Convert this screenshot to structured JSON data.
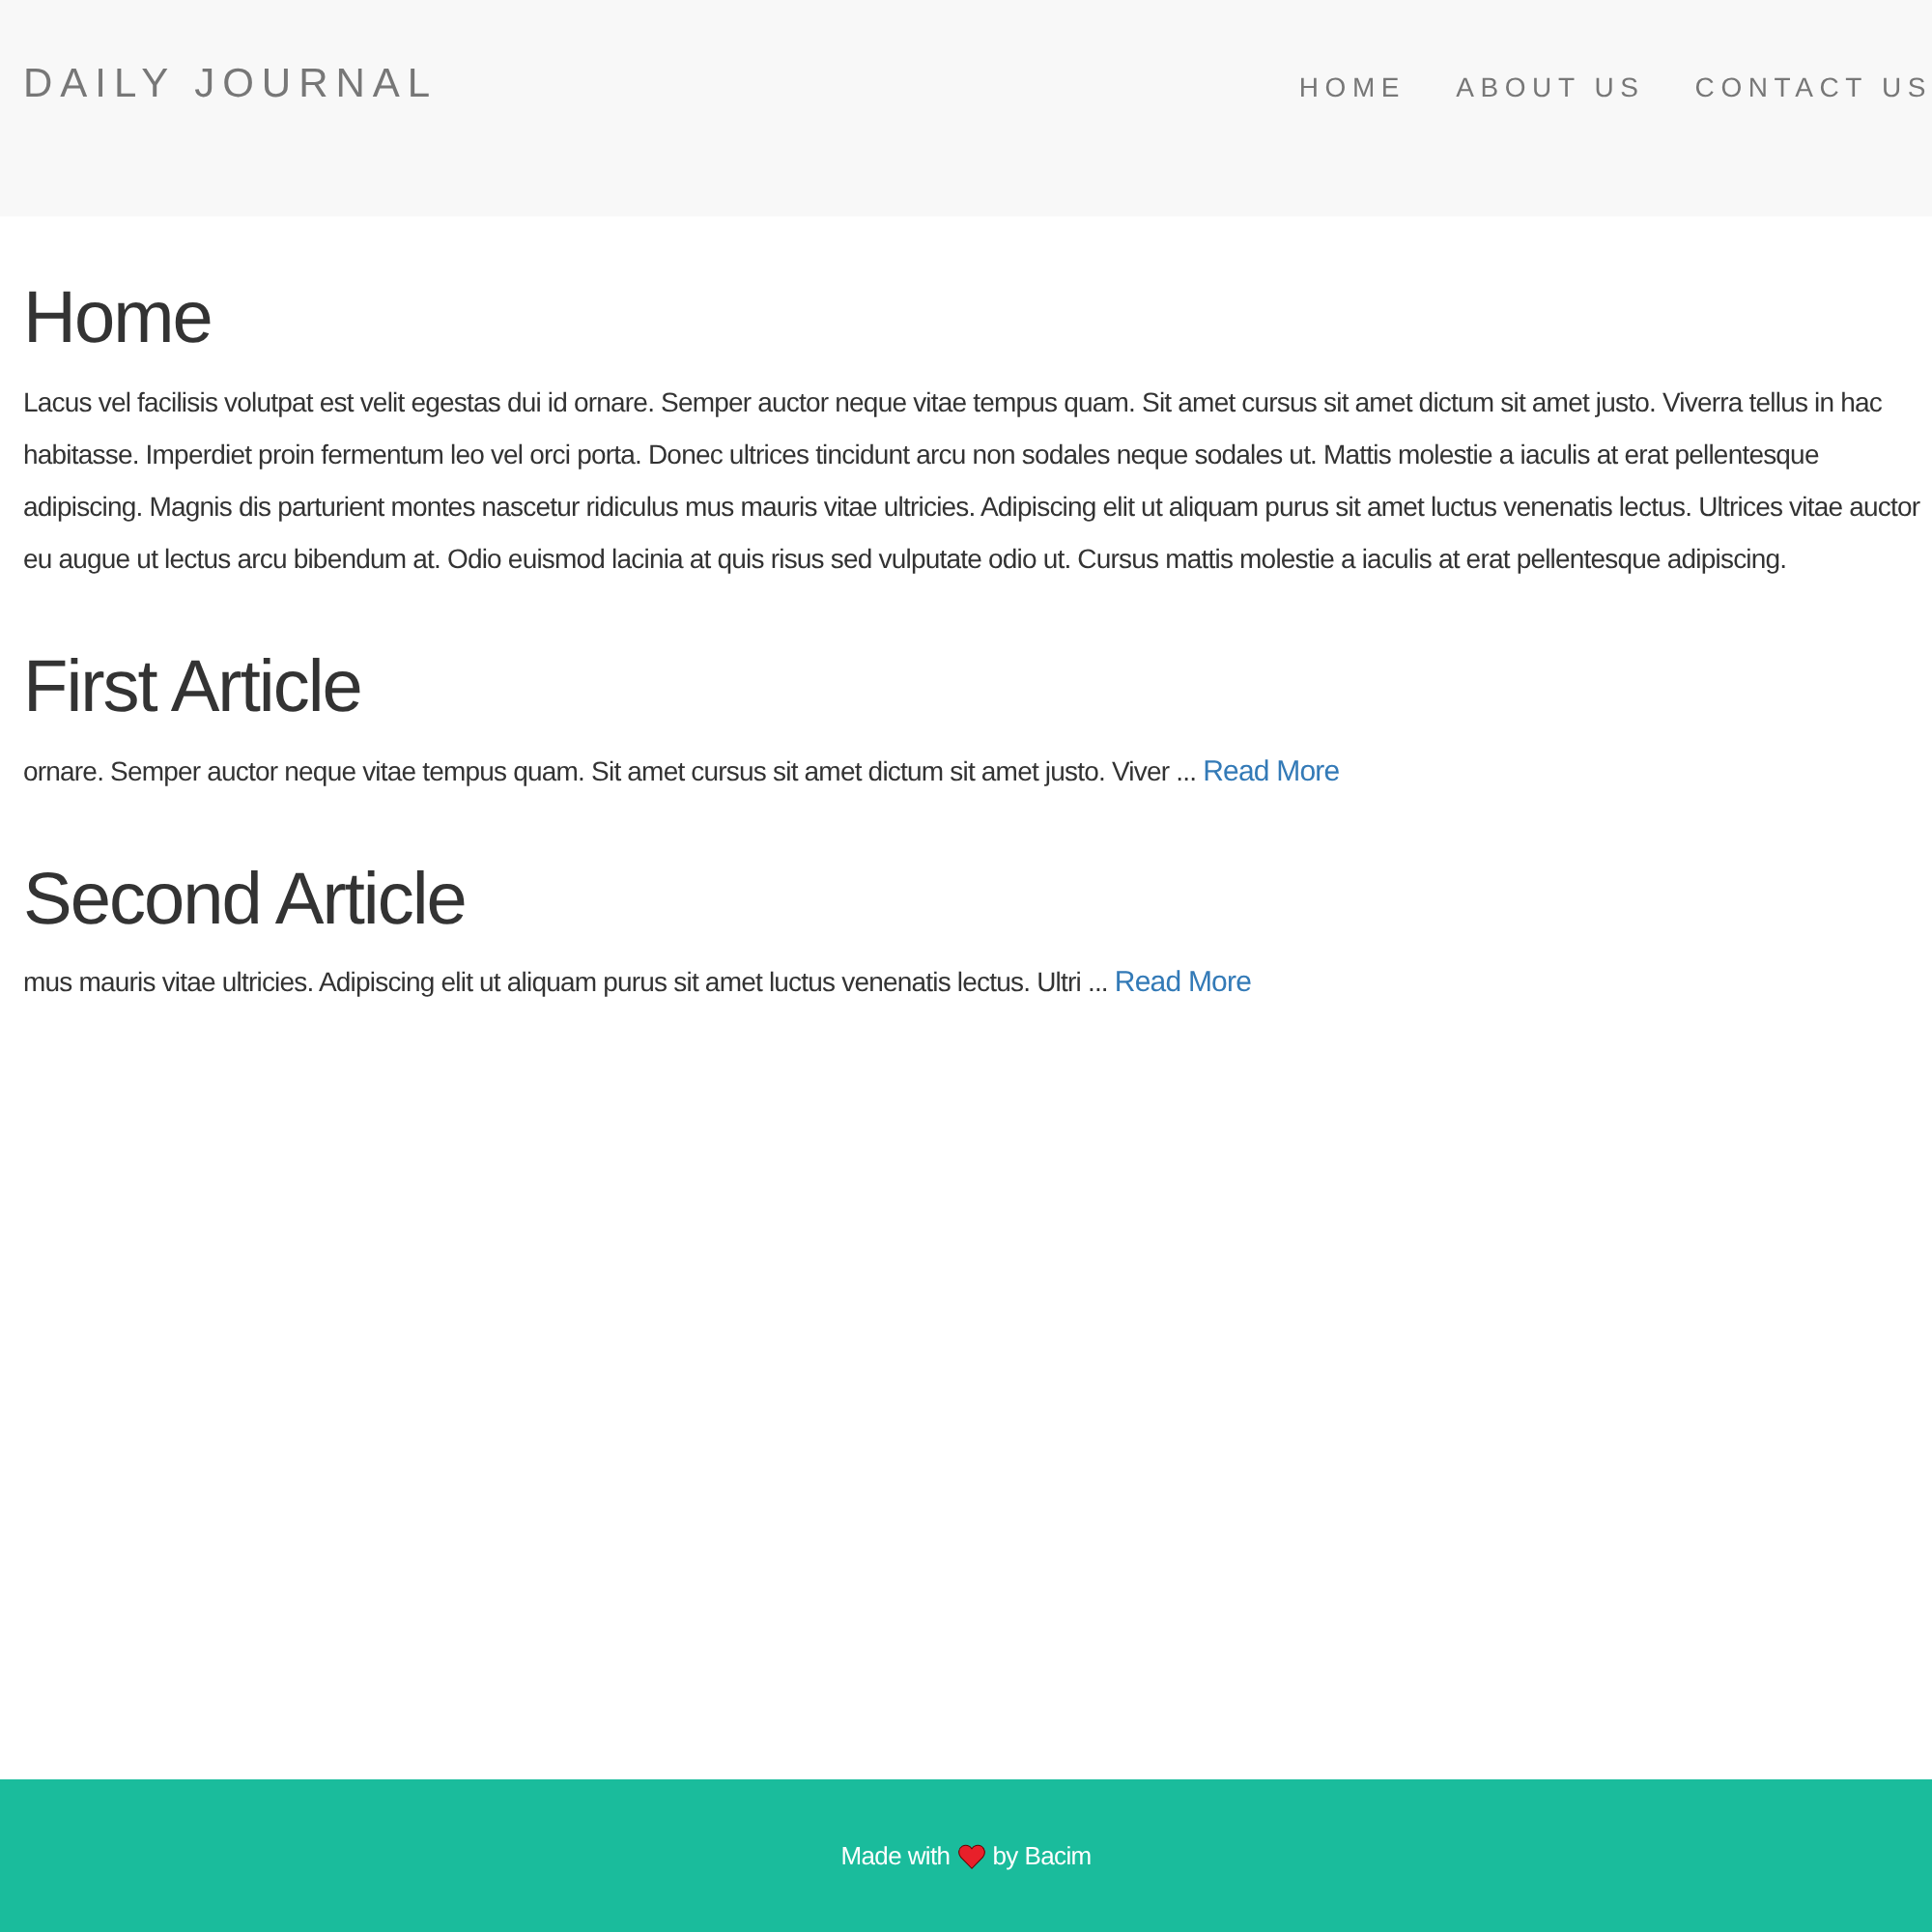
{
  "brand": "DAILY JOURNAL",
  "nav": [
    {
      "label": "HOME"
    },
    {
      "label": "ABOUT US"
    },
    {
      "label": "CONTACT US"
    }
  ],
  "intro": {
    "title": "Home",
    "text": "Lacus vel facilisis volutpat est velit egestas dui id ornare. Semper auctor neque vitae tempus quam. Sit amet cursus sit amet dictum sit amet justo. Viverra tellus in hac habitasse. Imperdiet proin fermentum leo vel orci porta. Donec ultrices tincidunt arcu non sodales neque sodales ut. Mattis molestie a iaculis at erat pellentesque adipiscing. Magnis dis parturient montes nascetur ridiculus mus mauris vitae ultricies. Adipiscing elit ut aliquam purus sit amet luctus venenatis lectus. Ultrices vitae auctor eu augue ut lectus arcu bibendum at. Odio euismod lacinia at quis risus sed vulputate odio ut. Cursus mattis molestie a iaculis at erat pellentesque adipiscing."
  },
  "posts": [
    {
      "title": "First Article",
      "excerpt": "ornare. Semper auctor neque vitae tempus quam. Sit amet cursus sit amet dictum sit amet justo. Viver ...",
      "link": "Read More"
    },
    {
      "title": "Second Article",
      "excerpt": "mus mauris vitae ultricies. Adipiscing elit ut aliquam purus sit amet luctus venenatis lectus. Ultri ...",
      "link": "Read More"
    }
  ],
  "footer": {
    "before": "Made with",
    "after": "by Bacim"
  }
}
